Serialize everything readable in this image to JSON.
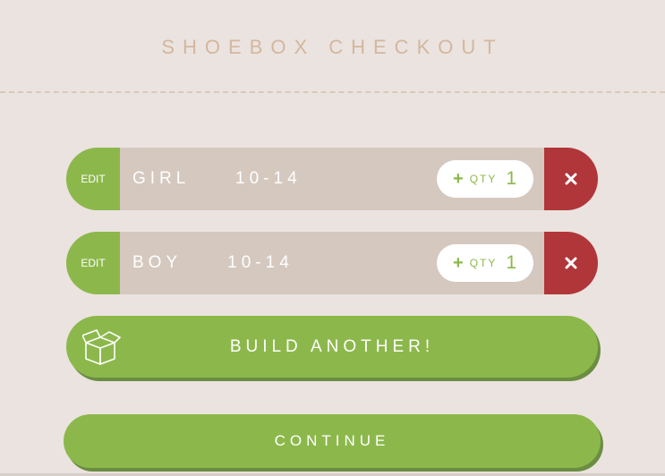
{
  "header": {
    "title": "SHOEBOX CHECKOUT"
  },
  "items": [
    {
      "edit_label": "EDIT",
      "gender": "GIRL",
      "age_range": "10-14",
      "label": "GIRL     10-14",
      "qty_plus": "+",
      "qty_label": "QTY",
      "qty": "1"
    },
    {
      "edit_label": "EDIT",
      "gender": "BOY",
      "age_range": "10-14",
      "label": "BOY     10-14",
      "qty_plus": "+",
      "qty_label": "QTY",
      "qty": "1"
    }
  ],
  "actions": {
    "build_another_label": "BUILD ANOTHER!",
    "continue_label": "CONTINUE"
  },
  "icons": {
    "remove": "close-icon",
    "build": "box-icon"
  },
  "colors": {
    "background": "#ebe3df",
    "title": "#d3b79e",
    "accent_green": "#8cb84b",
    "item_bg": "#d5c8bf",
    "remove_red": "#b0363a"
  }
}
